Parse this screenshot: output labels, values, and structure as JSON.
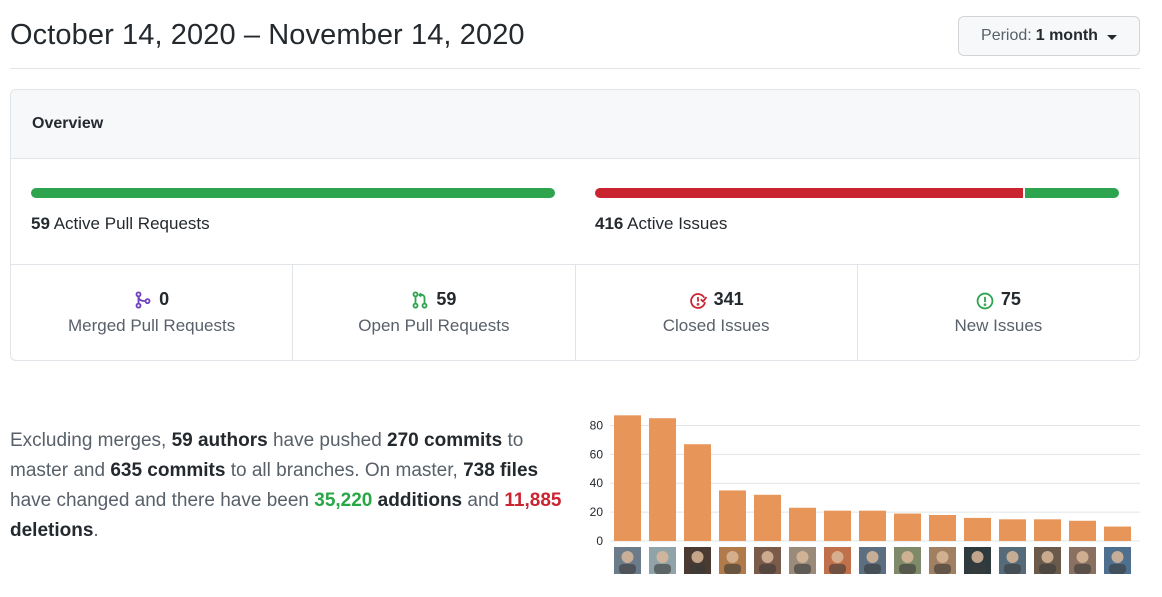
{
  "header": {
    "date_range": "October 14, 2020 – November 14, 2020",
    "period_prefix": "Period:",
    "period_value": "1 month"
  },
  "overview": {
    "title": "Overview",
    "pull_requests": {
      "count": "59",
      "label": "Active Pull Requests",
      "merged_fraction": 0,
      "open_fraction": 1
    },
    "issues": {
      "count": "416",
      "label": "Active Issues",
      "closed_fraction": 0.8197,
      "new_fraction": 0.1803
    },
    "stats": [
      {
        "value": "0",
        "label": "Merged Pull Requests",
        "icon": "git-merge-icon"
      },
      {
        "value": "59",
        "label": "Open Pull Requests",
        "icon": "git-pull-request-icon"
      },
      {
        "value": "341",
        "label": "Closed Issues",
        "icon": "issue-closed-icon"
      },
      {
        "value": "75",
        "label": "New Issues",
        "icon": "issue-opened-icon"
      }
    ]
  },
  "summary": {
    "t1": "Excluding merges, ",
    "authors": "59 authors",
    "t2": " have pushed ",
    "commits_master": "270 commits",
    "t3": " to master and ",
    "commits_all": "635 commits",
    "t4": " to all branches. On master, ",
    "files": "738 files",
    "t5": " have changed and there have been ",
    "additions_num": "35,220",
    "additions_word": " additions",
    "t6": " and ",
    "deletions_num": "11,885",
    "deletions_word": " deletions",
    "t7": "."
  },
  "colors": {
    "green": "#2ea44f",
    "red": "#cb2431",
    "purple": "#6f42c1",
    "bar": "#e8955a"
  },
  "chart_data": {
    "type": "bar",
    "categories": [
      "contributor-1",
      "contributor-2",
      "contributor-3",
      "contributor-4",
      "contributor-5",
      "contributor-6",
      "contributor-7",
      "contributor-8",
      "contributor-9",
      "contributor-10",
      "contributor-11",
      "contributor-12",
      "contributor-13",
      "contributor-14",
      "contributor-15"
    ],
    "values": [
      87,
      85,
      67,
      35,
      32,
      23,
      21,
      21,
      19,
      18,
      16,
      15,
      15,
      14,
      10
    ],
    "ylim": [
      0,
      90
    ],
    "yticks": [
      "0",
      "20",
      "40",
      "60",
      "80"
    ],
    "grid": true
  }
}
